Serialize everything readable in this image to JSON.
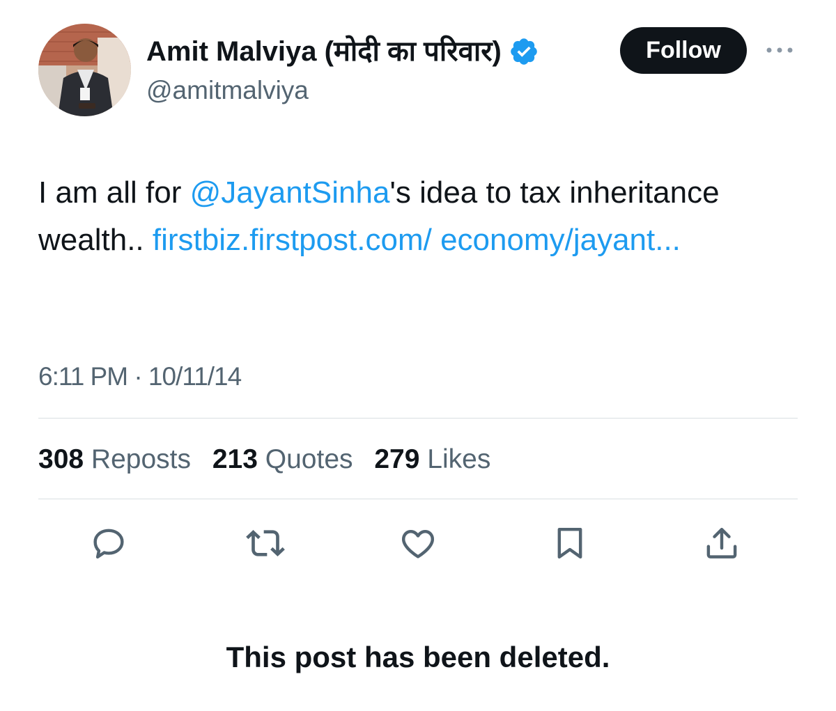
{
  "author": {
    "display_name": "Amit Malviya (मोदी का परिवार)",
    "handle": "@amitmalviya",
    "verified_icon": "verified-badge-icon",
    "avatar_icon": "profile-photo"
  },
  "follow_label": "Follow",
  "more_icon": "more-horizontal-icon",
  "tweet": {
    "text_before_mention": "I am all for ",
    "mention": "@JayantSinha",
    "text_after_mention": "'s idea to tax inheritance wealth.. ",
    "link_text": "firstbiz.firstpost.com/ economy/jayant..."
  },
  "timestamp": "6:11 PM · 10/11/14",
  "stats": {
    "reposts_count": "308",
    "reposts_label": "Reposts",
    "quotes_count": "213",
    "quotes_label": "Quotes",
    "likes_count": "279",
    "likes_label": "Likes"
  },
  "actions": [
    "reply-icon",
    "repost-icon",
    "like-icon",
    "bookmark-icon",
    "share-icon"
  ],
  "deleted_notice": "This post has been deleted.",
  "colors": {
    "link": "#1d9bf0",
    "verified": "#1d9bf0",
    "secondary_text": "#536471",
    "primary_text": "#0f1419",
    "follow_bg": "#0f1419"
  }
}
